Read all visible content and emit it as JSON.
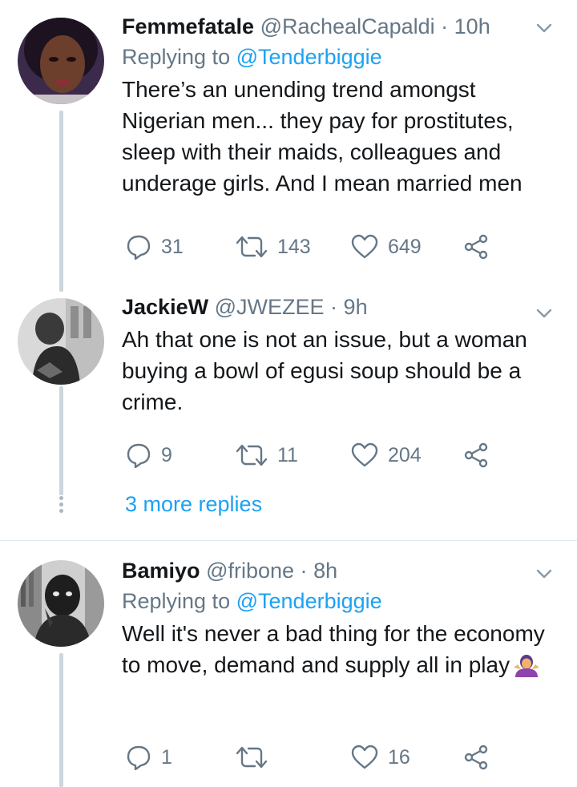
{
  "tweets": [
    {
      "name": "Femmefatale",
      "handle": "@RachealCapaldi",
      "time": "10h",
      "replying_prefix": "Replying to",
      "replying_to": "@Tenderbiggie",
      "text": "There’s an unending trend amongst Nigerian men... they pay for prostitutes, sleep with their maids, colleagues and underage girls. And I mean married men",
      "replies": "31",
      "retweets": "143",
      "likes": "649"
    },
    {
      "name": "JackieW",
      "handle": "@JWEZEE",
      "time": "9h",
      "text": "Ah that one is not an issue, but a woman buying a bowl of egusi soup should be a crime.",
      "replies": "9",
      "retweets": "11",
      "likes": "204"
    },
    {
      "name": "Bamiyo",
      "handle": "@fribone",
      "time": "8h",
      "replying_prefix": "Replying to",
      "replying_to": "@Tenderbiggie",
      "text": "Well it's never a bad thing for the economy to move, demand and supply all in play",
      "replies": "1",
      "retweets": "",
      "likes": "16"
    }
  ],
  "more_replies_label": "3 more replies",
  "colors": {
    "accent": "#1da1f2",
    "muted": "#657786",
    "thread": "#ccd6dd"
  },
  "icons": [
    "reply-icon",
    "retweet-icon",
    "like-icon",
    "share-icon",
    "chevron-down-icon",
    "shrug-emoji"
  ]
}
